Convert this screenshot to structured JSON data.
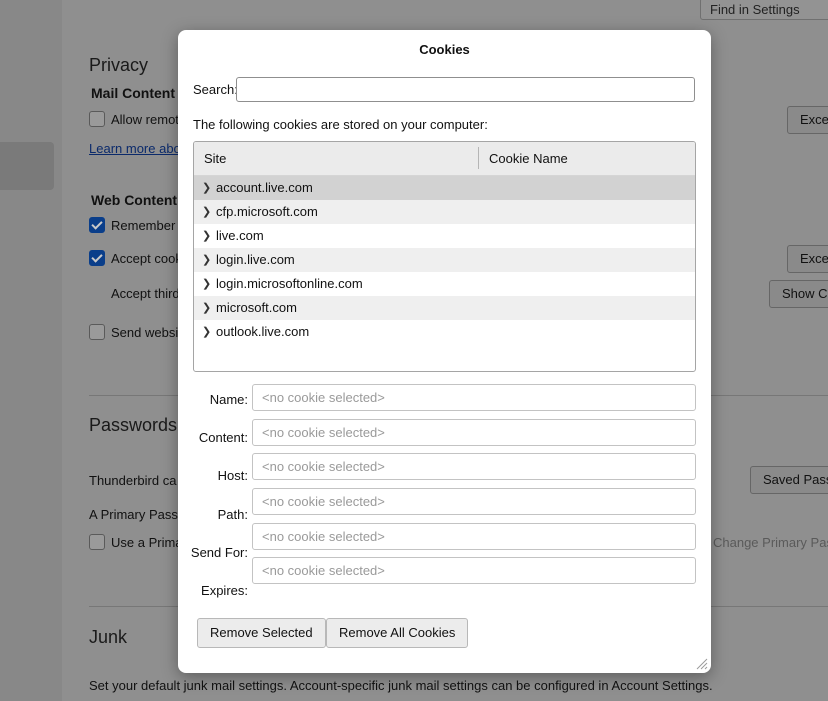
{
  "background": {
    "find_placeholder": "Find in Settings",
    "privacy_heading": "Privacy",
    "mail_content_heading": "Mail Content",
    "allow_remote": "Allow remot",
    "exceptions_1": "Exce",
    "learn_more": "Learn more abo",
    "web_content_heading": "Web Content",
    "remember": "Remember v",
    "accept_cookies": "Accept cook",
    "exceptions_2": "Exce",
    "accept_third": "Accept third",
    "show_cookies": "Show Co",
    "send_websites": "Send websit",
    "passwords_heading": "Passwords",
    "thunderbird_can": "Thunderbird ca",
    "saved_passwords": "Saved Pass",
    "primary_password_desc": "A Primary Passw",
    "use_primary": "Use a Prima",
    "change_primary": "Change Primary Pas",
    "junk_heading": "Junk",
    "junk_desc": "Set your default junk mail settings. Account-specific junk mail settings can be configured in Account Settings."
  },
  "dialog": {
    "title": "Cookies",
    "search_label": "Search:",
    "search_value": "",
    "intro": "The following cookies are stored on your computer:",
    "columns": {
      "site": "Site",
      "cookie_name": "Cookie Name"
    },
    "sites": [
      "account.live.com",
      "cfp.microsoft.com",
      "live.com",
      "login.live.com",
      "login.microsoftonline.com",
      "microsoft.com",
      "outlook.live.com"
    ],
    "fields": {
      "name_label": "Name:",
      "content_label": "Content:",
      "host_label": "Host:",
      "path_label": "Path:",
      "send_for_label": "Send For:",
      "expires_label": "Expires:",
      "placeholder": "<no cookie selected>"
    },
    "remove_selected": "Remove Selected",
    "remove_all": "Remove All Cookies"
  }
}
